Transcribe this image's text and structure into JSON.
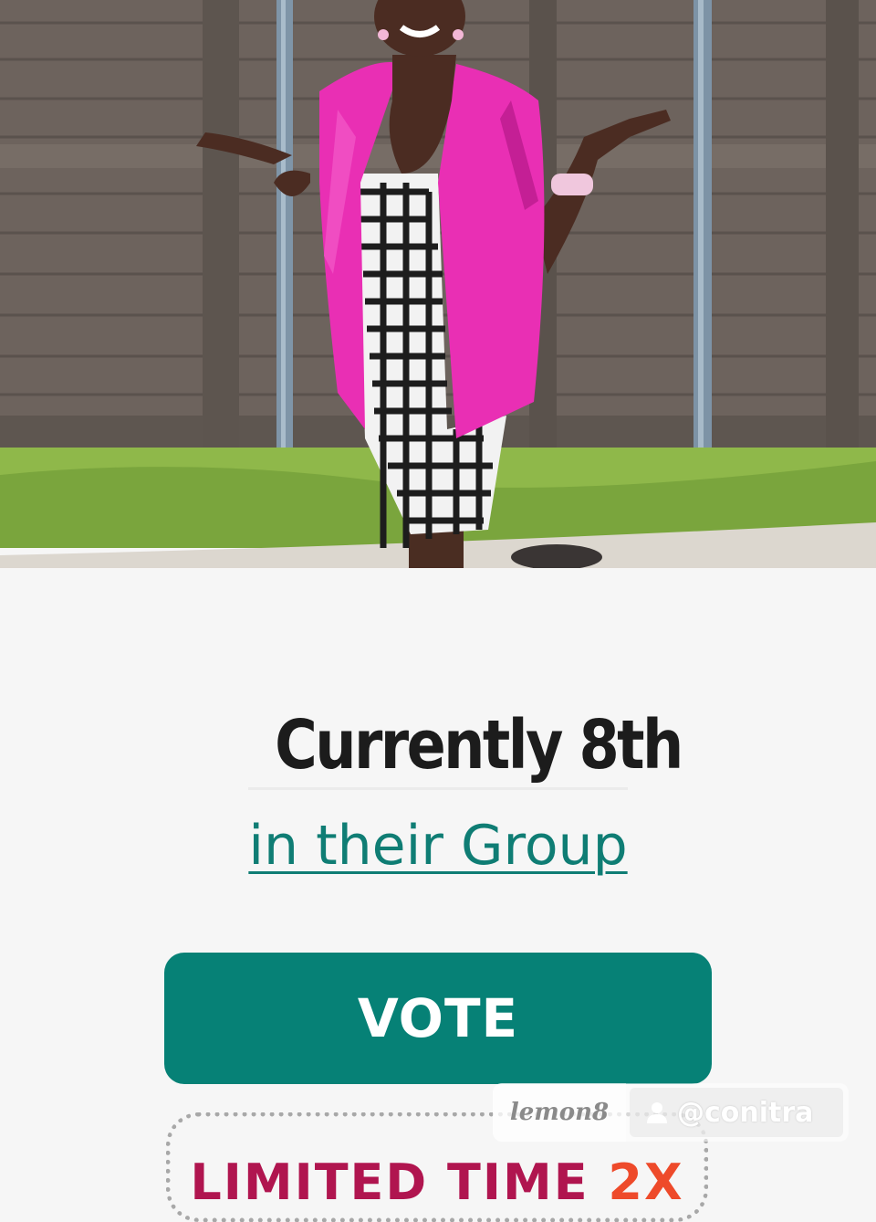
{
  "ranking": {
    "title": "Currently 8th",
    "group_link": "in their Group"
  },
  "vote_button": {
    "label": "VOTE"
  },
  "promo": {
    "text_prefix": "LIMITED TIME ",
    "text_multiplier": "2X"
  },
  "watermark": {
    "brand": "lemon8",
    "username": "@conitra"
  },
  "colors": {
    "accent": "#068176",
    "link": "#0f7d74",
    "promo": "#b0154f",
    "blazer": "#e92fb4"
  },
  "icons": [
    "user-icon"
  ]
}
